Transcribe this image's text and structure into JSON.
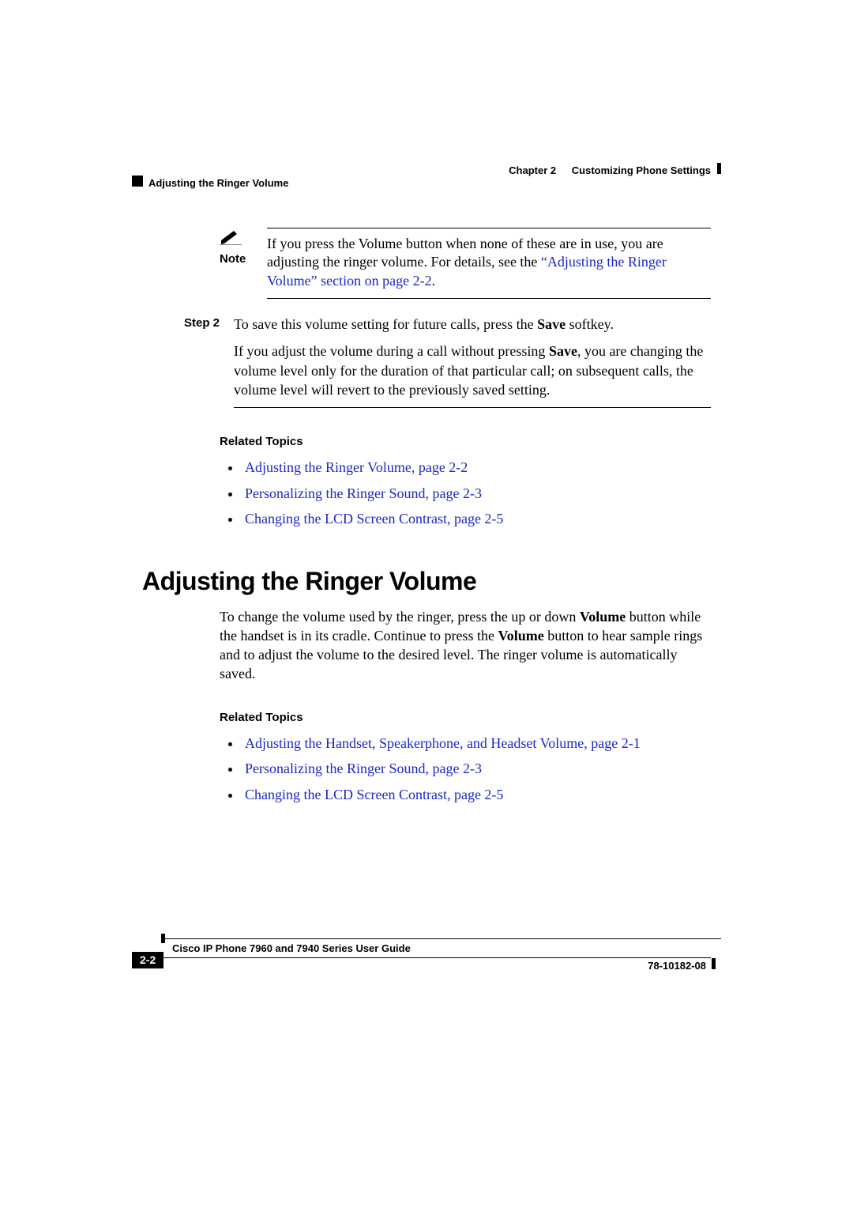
{
  "header": {
    "chapter_label": "Chapter 2",
    "chapter_title": "Customizing Phone Settings",
    "section_running": "Adjusting the Ringer Volume"
  },
  "note": {
    "label": "Note",
    "text_before_link": "If you press the Volume button when none of these are in use, you are adjusting the ringer volume. For details, see the ",
    "link_text": "“Adjusting the Ringer Volume” section on page 2-2",
    "text_after_link": "."
  },
  "step": {
    "label": "Step 2",
    "sentence1_before_bold": "To save this volume setting for future calls, press the ",
    "sentence1_bold": "Save",
    "sentence1_after_bold": " softkey.",
    "para2_before_bold": "If you adjust the volume during a call without pressing ",
    "para2_bold": "Save",
    "para2_after_bold": ", you are changing the volume level only for the duration of that particular call; on subsequent calls, the volume level will revert to the previously saved setting."
  },
  "related1": {
    "heading": "Related Topics",
    "items": [
      "Adjusting the Ringer Volume, page 2-2",
      "Personalizing the Ringer Sound, page 2-3",
      "Changing the LCD Screen Contrast, page 2-5"
    ]
  },
  "section": {
    "title": "Adjusting the Ringer Volume",
    "p_before_b1": "To change the volume used by the ringer, press the up or down ",
    "b1": "Volume",
    "p_between": " button while the handset is in its cradle. Continue to press the ",
    "b2": "Volume",
    "p_after_b2": " button to hear sample rings and to adjust the volume to the desired level. The ringer volume is automatically saved."
  },
  "related2": {
    "heading": "Related Topics",
    "items": [
      "Adjusting the Handset, Speakerphone, and Headset Volume, page 2-1",
      "Personalizing the Ringer Sound, page 2-3",
      "Changing the LCD Screen Contrast, page 2-5"
    ]
  },
  "footer": {
    "guide_title": "Cisco IP Phone 7960 and 7940 Series User Guide",
    "page_number": "2-2",
    "doc_number": "78-10182-08"
  }
}
